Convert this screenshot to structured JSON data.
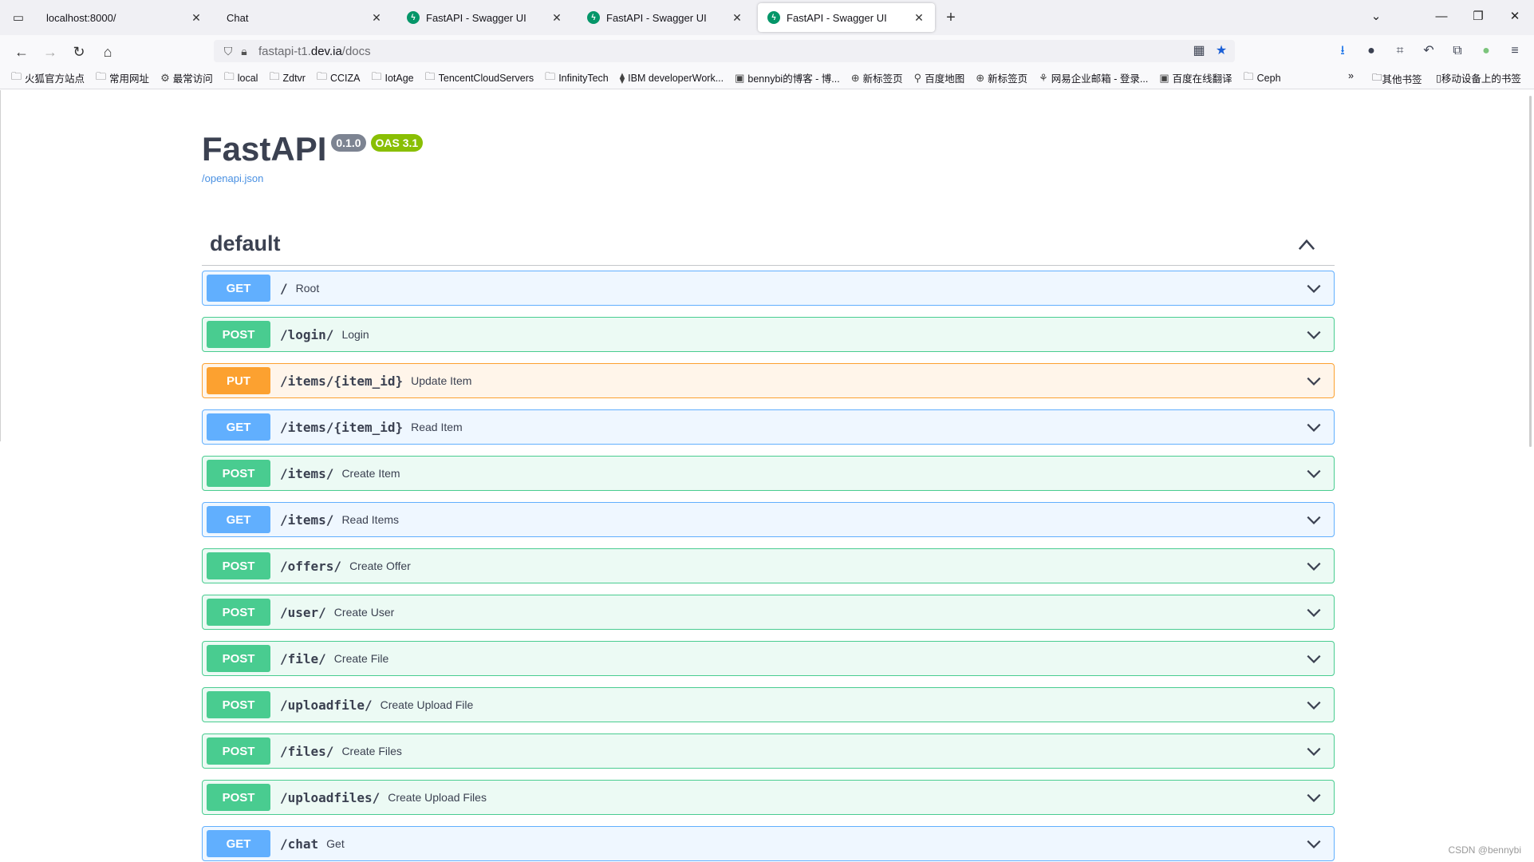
{
  "browser": {
    "tabs": [
      {
        "title": "localhost:8000/",
        "active": false
      },
      {
        "title": "Chat",
        "active": false
      },
      {
        "title": "FastAPI - Swagger UI",
        "active": false
      },
      {
        "title": "FastAPI - Swagger UI",
        "active": false
      },
      {
        "title": "FastAPI - Swagger UI",
        "active": true
      }
    ],
    "url": {
      "prefix": "fastapi-t1.",
      "host": "dev.ia",
      "path": "/docs"
    },
    "bookmarks": [
      "火狐官方站点",
      "常用网址",
      "最常访问",
      "local",
      "Zdtvr",
      "CCIZA",
      "IotAge",
      "TencentCloudServers",
      "InfinityTech",
      "IBM developerWork...",
      "bennybi的博客 - 博...",
      "新标签页",
      "百度地图",
      "新标签页",
      "网易企业邮箱 - 登录...",
      "百度在线翻译",
      "Ceph"
    ],
    "bookmarks_right": [
      "其他书签",
      "移动设备上的书签"
    ]
  },
  "swagger": {
    "title": "FastAPI",
    "version": "0.1.0",
    "oas": "OAS 3.1",
    "openapi_link": "/openapi.json",
    "section": "default",
    "operations": [
      {
        "method": "GET",
        "path": "/",
        "summary": "Root"
      },
      {
        "method": "POST",
        "path": "/login/",
        "summary": "Login"
      },
      {
        "method": "PUT",
        "path": "/items/{item_id}",
        "summary": "Update Item"
      },
      {
        "method": "GET",
        "path": "/items/{item_id}",
        "summary": "Read Item"
      },
      {
        "method": "POST",
        "path": "/items/",
        "summary": "Create Item"
      },
      {
        "method": "GET",
        "path": "/items/",
        "summary": "Read Items"
      },
      {
        "method": "POST",
        "path": "/offers/",
        "summary": "Create Offer"
      },
      {
        "method": "POST",
        "path": "/user/",
        "summary": "Create User"
      },
      {
        "method": "POST",
        "path": "/file/",
        "summary": "Create File"
      },
      {
        "method": "POST",
        "path": "/uploadfile/",
        "summary": "Create Upload File"
      },
      {
        "method": "POST",
        "path": "/files/",
        "summary": "Create Files"
      },
      {
        "method": "POST",
        "path": "/uploadfiles/",
        "summary": "Create Upload Files"
      },
      {
        "method": "GET",
        "path": "/chat",
        "summary": "Get"
      }
    ]
  },
  "watermark": "CSDN @bennybi",
  "colors": {
    "get": "#61affe",
    "post": "#49cc90",
    "put": "#fca130",
    "link": "#4990e2"
  }
}
